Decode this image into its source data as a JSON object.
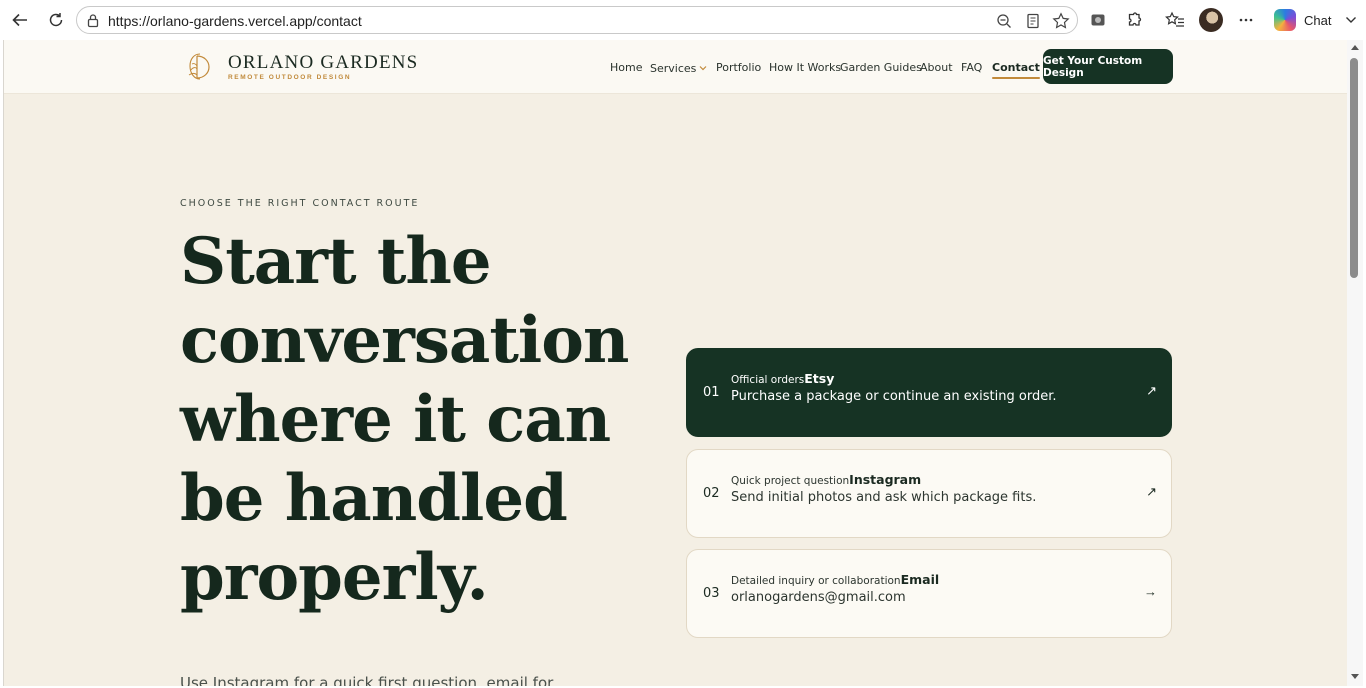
{
  "browser": {
    "url": "https://orlano-gardens.vercel.app/contact",
    "chat_label": "Chat",
    "icons": [
      "back-icon",
      "refresh-icon",
      "lock-icon",
      "zoom-out-icon",
      "reader-icon",
      "favorite-star-icon",
      "screenshot-icon",
      "extensions-icon",
      "favorites-list-icon",
      "more-icon",
      "copilot-icon",
      "chevron-down-icon"
    ]
  },
  "site": {
    "logo_title": "ORLANO GARDENS",
    "logo_subtitle": "REMOTE OUTDOOR DESIGN",
    "nav": {
      "home": "Home",
      "services": "Services",
      "portfolio": "Portfolio",
      "how_it_works": "How It Works",
      "garden_guides": "Garden Guides",
      "about": "About",
      "faq": "FAQ",
      "contact": "Contact",
      "active": "Contact"
    },
    "cta_label": "Get Your Custom Design"
  },
  "hero": {
    "eyebrow": "CHOOSE THE RIGHT CONTACT ROUTE",
    "headline": "Start the conversation where it can be handled properly.",
    "subtext": "Use Instagram for a quick first question, email for"
  },
  "contact_routes": [
    {
      "number": "01",
      "label": "Official orders",
      "channel": "Etsy",
      "description": "Purchase a package or continue an existing order.",
      "arrow": "↗"
    },
    {
      "number": "02",
      "label": "Quick project question",
      "channel": "Instagram",
      "description": "Send initial photos and ask which package fits.",
      "arrow": "↗"
    },
    {
      "number": "03",
      "label": "Detailed inquiry or collaboration",
      "channel": "Email",
      "description": "orlanogardens@gmail.com",
      "arrow": "→"
    }
  ],
  "colors": {
    "background": "#f4efe4",
    "header": "#fbf9f3",
    "brand_dark": "#163324",
    "accent_gold": "#c28a3a",
    "text_dark": "#15281d"
  }
}
